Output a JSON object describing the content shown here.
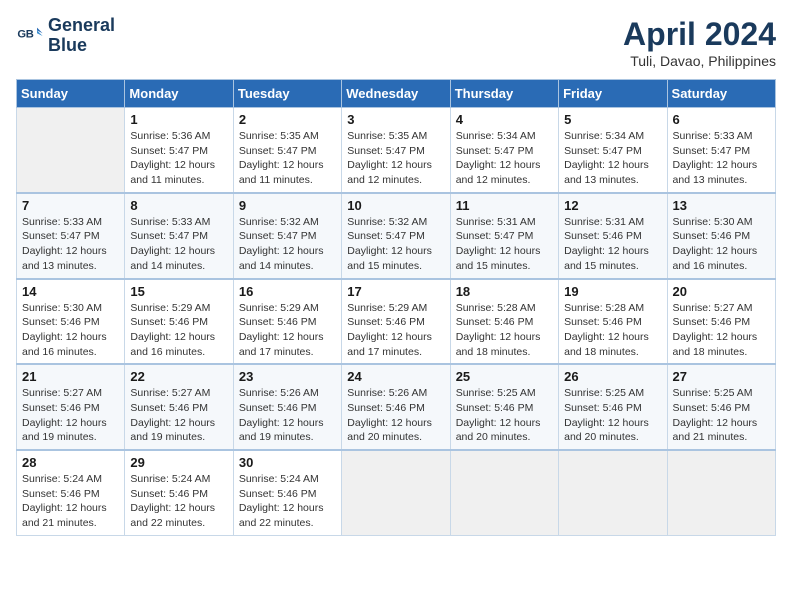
{
  "header": {
    "logo_line1": "General",
    "logo_line2": "Blue",
    "month": "April 2024",
    "location": "Tuli, Davao, Philippines"
  },
  "weekdays": [
    "Sunday",
    "Monday",
    "Tuesday",
    "Wednesday",
    "Thursday",
    "Friday",
    "Saturday"
  ],
  "weeks": [
    [
      {
        "day": "",
        "info": ""
      },
      {
        "day": "1",
        "info": "Sunrise: 5:36 AM\nSunset: 5:47 PM\nDaylight: 12 hours\nand 11 minutes."
      },
      {
        "day": "2",
        "info": "Sunrise: 5:35 AM\nSunset: 5:47 PM\nDaylight: 12 hours\nand 11 minutes."
      },
      {
        "day": "3",
        "info": "Sunrise: 5:35 AM\nSunset: 5:47 PM\nDaylight: 12 hours\nand 12 minutes."
      },
      {
        "day": "4",
        "info": "Sunrise: 5:34 AM\nSunset: 5:47 PM\nDaylight: 12 hours\nand 12 minutes."
      },
      {
        "day": "5",
        "info": "Sunrise: 5:34 AM\nSunset: 5:47 PM\nDaylight: 12 hours\nand 13 minutes."
      },
      {
        "day": "6",
        "info": "Sunrise: 5:33 AM\nSunset: 5:47 PM\nDaylight: 12 hours\nand 13 minutes."
      }
    ],
    [
      {
        "day": "7",
        "info": "Sunrise: 5:33 AM\nSunset: 5:47 PM\nDaylight: 12 hours\nand 13 minutes."
      },
      {
        "day": "8",
        "info": "Sunrise: 5:33 AM\nSunset: 5:47 PM\nDaylight: 12 hours\nand 14 minutes."
      },
      {
        "day": "9",
        "info": "Sunrise: 5:32 AM\nSunset: 5:47 PM\nDaylight: 12 hours\nand 14 minutes."
      },
      {
        "day": "10",
        "info": "Sunrise: 5:32 AM\nSunset: 5:47 PM\nDaylight: 12 hours\nand 15 minutes."
      },
      {
        "day": "11",
        "info": "Sunrise: 5:31 AM\nSunset: 5:47 PM\nDaylight: 12 hours\nand 15 minutes."
      },
      {
        "day": "12",
        "info": "Sunrise: 5:31 AM\nSunset: 5:46 PM\nDaylight: 12 hours\nand 15 minutes."
      },
      {
        "day": "13",
        "info": "Sunrise: 5:30 AM\nSunset: 5:46 PM\nDaylight: 12 hours\nand 16 minutes."
      }
    ],
    [
      {
        "day": "14",
        "info": "Sunrise: 5:30 AM\nSunset: 5:46 PM\nDaylight: 12 hours\nand 16 minutes."
      },
      {
        "day": "15",
        "info": "Sunrise: 5:29 AM\nSunset: 5:46 PM\nDaylight: 12 hours\nand 16 minutes."
      },
      {
        "day": "16",
        "info": "Sunrise: 5:29 AM\nSunset: 5:46 PM\nDaylight: 12 hours\nand 17 minutes."
      },
      {
        "day": "17",
        "info": "Sunrise: 5:29 AM\nSunset: 5:46 PM\nDaylight: 12 hours\nand 17 minutes."
      },
      {
        "day": "18",
        "info": "Sunrise: 5:28 AM\nSunset: 5:46 PM\nDaylight: 12 hours\nand 18 minutes."
      },
      {
        "day": "19",
        "info": "Sunrise: 5:28 AM\nSunset: 5:46 PM\nDaylight: 12 hours\nand 18 minutes."
      },
      {
        "day": "20",
        "info": "Sunrise: 5:27 AM\nSunset: 5:46 PM\nDaylight: 12 hours\nand 18 minutes."
      }
    ],
    [
      {
        "day": "21",
        "info": "Sunrise: 5:27 AM\nSunset: 5:46 PM\nDaylight: 12 hours\nand 19 minutes."
      },
      {
        "day": "22",
        "info": "Sunrise: 5:27 AM\nSunset: 5:46 PM\nDaylight: 12 hours\nand 19 minutes."
      },
      {
        "day": "23",
        "info": "Sunrise: 5:26 AM\nSunset: 5:46 PM\nDaylight: 12 hours\nand 19 minutes."
      },
      {
        "day": "24",
        "info": "Sunrise: 5:26 AM\nSunset: 5:46 PM\nDaylight: 12 hours\nand 20 minutes."
      },
      {
        "day": "25",
        "info": "Sunrise: 5:25 AM\nSunset: 5:46 PM\nDaylight: 12 hours\nand 20 minutes."
      },
      {
        "day": "26",
        "info": "Sunrise: 5:25 AM\nSunset: 5:46 PM\nDaylight: 12 hours\nand 20 minutes."
      },
      {
        "day": "27",
        "info": "Sunrise: 5:25 AM\nSunset: 5:46 PM\nDaylight: 12 hours\nand 21 minutes."
      }
    ],
    [
      {
        "day": "28",
        "info": "Sunrise: 5:24 AM\nSunset: 5:46 PM\nDaylight: 12 hours\nand 21 minutes."
      },
      {
        "day": "29",
        "info": "Sunrise: 5:24 AM\nSunset: 5:46 PM\nDaylight: 12 hours\nand 22 minutes."
      },
      {
        "day": "30",
        "info": "Sunrise: 5:24 AM\nSunset: 5:46 PM\nDaylight: 12 hours\nand 22 minutes."
      },
      {
        "day": "",
        "info": ""
      },
      {
        "day": "",
        "info": ""
      },
      {
        "day": "",
        "info": ""
      },
      {
        "day": "",
        "info": ""
      }
    ]
  ]
}
